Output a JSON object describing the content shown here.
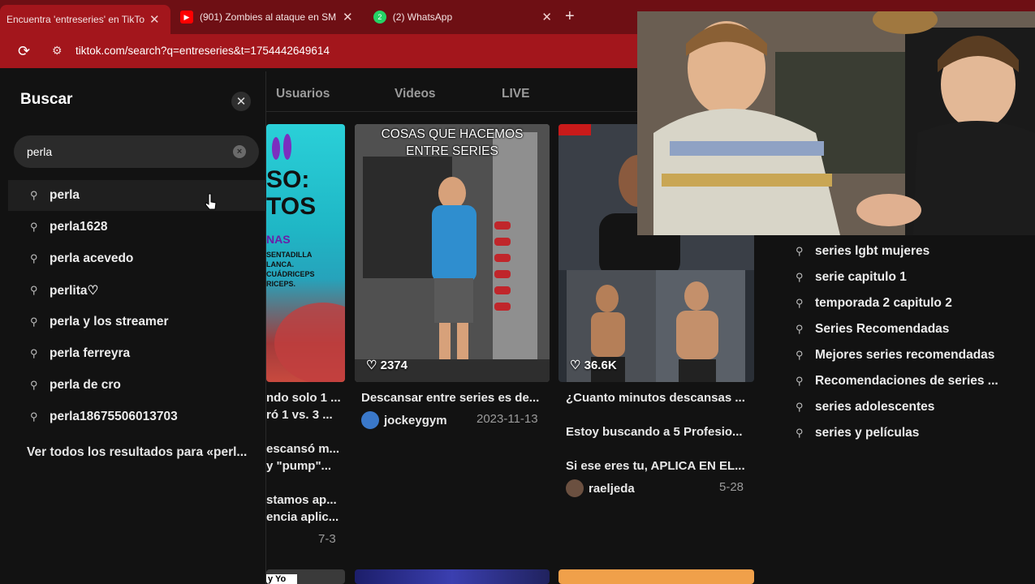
{
  "browser": {
    "tabs": [
      {
        "title": "Encuentra 'entreseries' en TikTo",
        "active": true
      },
      {
        "title": "(901) Zombies al ataque en SM",
        "icon": "youtube-icon"
      },
      {
        "title": "(2) WhatsApp",
        "icon": "whatsapp-icon"
      }
    ],
    "new_tab": "+",
    "close_glyph": "✕",
    "url": "tiktok.com/search?q=entreseries&t=1754442649614"
  },
  "search_panel": {
    "title": "Buscar",
    "query": "perla",
    "suggestions": [
      "perla",
      "perla1628",
      "perla acevedo",
      "perlita♡",
      "perla y los streamer",
      "perla ferreyra",
      "perla de cro",
      "perla18675506013703"
    ],
    "view_all": "Ver todos los resultados para «perl..."
  },
  "result_tabs": [
    "Usuarios",
    "Videos",
    "LIVE"
  ],
  "videos": [
    {
      "overlay_lines": [
        "SO:",
        "TOS",
        "NAS",
        "SENTADILLA",
        "LANCA.",
        "CUÁDRICEPS",
        "RICEPS."
      ],
      "caption_lines": [
        "ndo solo 1 ...",
        "ró 1 vs. 3 ...",
        "escansó m...",
        "y \"pump\"...",
        "stamos ap...",
        "encia aplic..."
      ],
      "date": "7-3"
    },
    {
      "overlay_lines": [
        "COSAS QUE HACEMOS",
        "ENTRE SERIES"
      ],
      "likes": "2374",
      "caption": "Descansar entre series es de...",
      "user": "jockeygym",
      "date": "2023-11-13"
    },
    {
      "likes": "36.6K",
      "caption_lines": [
        "¿Cuanto minutos descansas ...",
        "Estoy buscando a 5 Profesio...",
        "Si ese eres tu, APLICA EN EL..."
      ],
      "user": "raeljeda",
      "date": "5-28"
    }
  ],
  "bottom_partial_label": "y Yo",
  "related_searches": [
    "series lgbt mujeres",
    "serie capitulo 1",
    "temporada 2 capitulo 2",
    "Series Recomendadas",
    "Mejores series recomendadas",
    "Recomendaciones de series ...",
    "series adolescentes",
    "series y películas"
  ],
  "colors": {
    "tab_bar": "#6e0f14",
    "address_bar": "#a3161c",
    "page_bg": "#121212"
  }
}
